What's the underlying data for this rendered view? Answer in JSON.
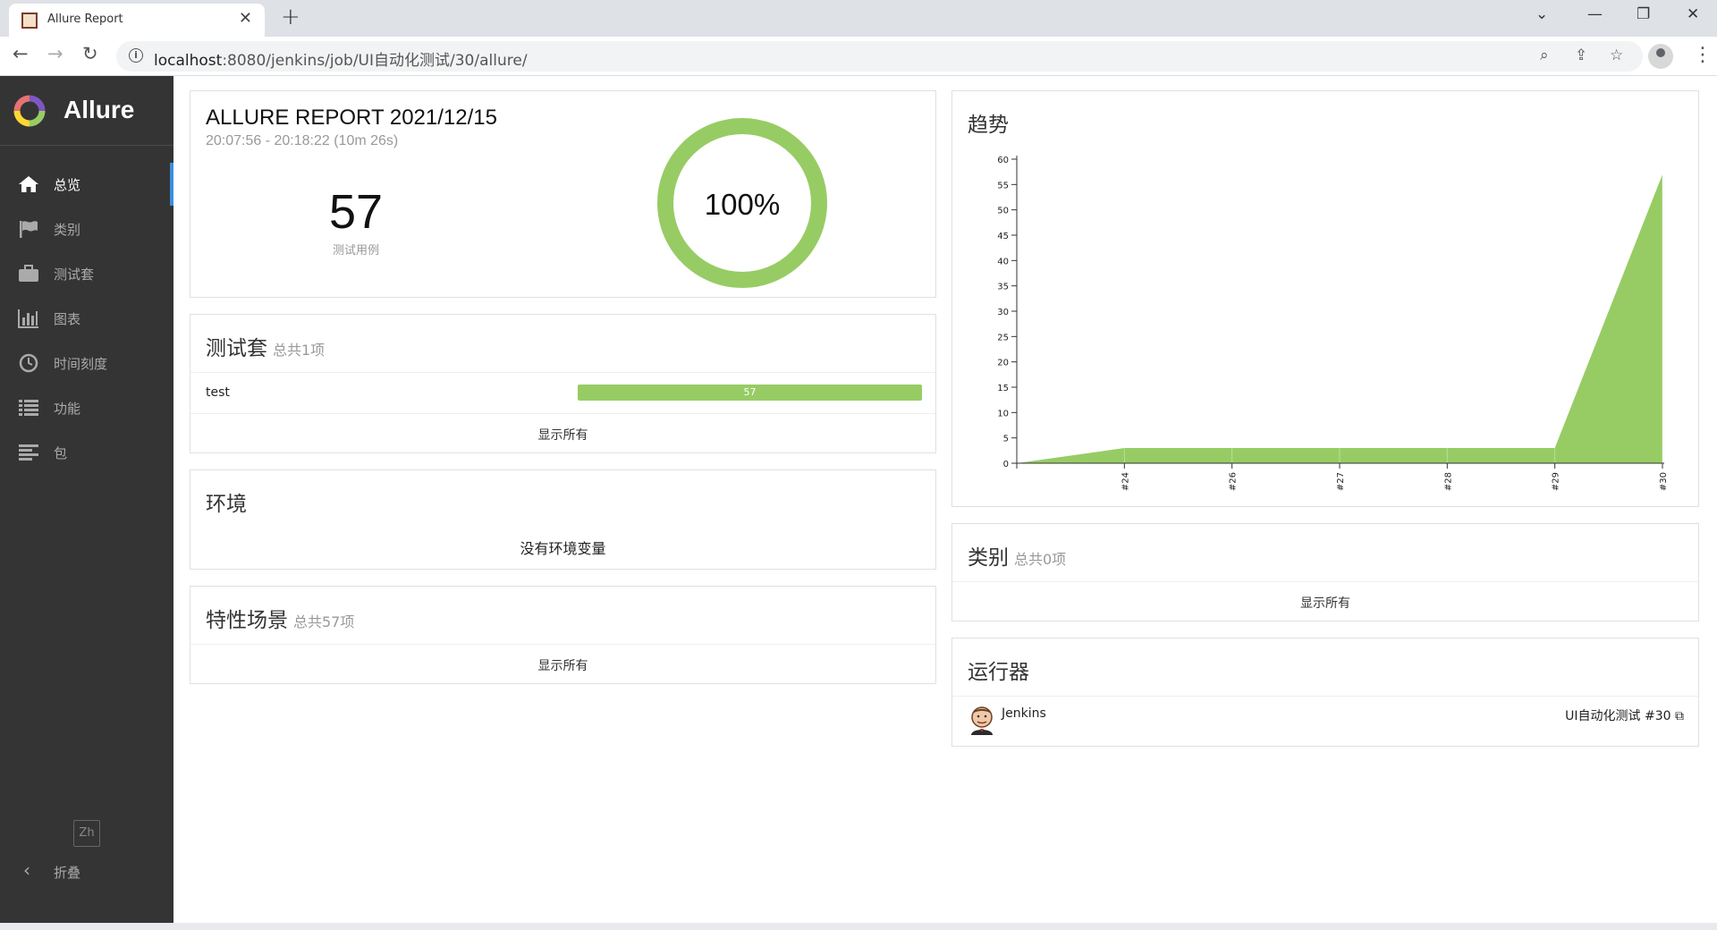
{
  "browser": {
    "tab_title": "Allure Report",
    "url_host": "localhost",
    "url_path": ":8080/jenkins/job/UI自动化测试/30/allure/"
  },
  "sidebar": {
    "brand": "Allure",
    "items": [
      {
        "label": "总览",
        "icon": "home-icon",
        "active": true
      },
      {
        "label": "类别",
        "icon": "flag-icon",
        "active": false
      },
      {
        "label": "测试套",
        "icon": "briefcase-icon",
        "active": false
      },
      {
        "label": "图表",
        "icon": "bar-chart-icon",
        "active": false
      },
      {
        "label": "时间刻度",
        "icon": "clock-icon",
        "active": false
      },
      {
        "label": "功能",
        "icon": "list-icon",
        "active": false
      },
      {
        "label": "包",
        "icon": "align-left-icon",
        "active": false
      }
    ],
    "language": "Zh",
    "collapse_label": "折叠"
  },
  "summary": {
    "title": "ALLURE REPORT 2021/12/15",
    "time_range": "20:07:56 - 20:18:22 (10m 26s)",
    "test_count": "57",
    "test_count_label": "测试用例",
    "success_rate": "100%",
    "success_fraction": 1.0
  },
  "suites": {
    "title": "测试套",
    "subtitle": "总共1项",
    "rows": [
      {
        "name": "test",
        "count": "57"
      }
    ],
    "show_all": "显示所有"
  },
  "environment": {
    "title": "环境",
    "empty_text": "没有环境变量"
  },
  "features": {
    "title": "特性场景",
    "subtitle": "总共57项",
    "show_all": "显示所有"
  },
  "trend": {
    "title": "趋势"
  },
  "categories": {
    "title": "类别",
    "subtitle": "总共0项",
    "show_all": "显示所有"
  },
  "executors": {
    "title": "运行器",
    "name": "Jenkins",
    "build_link": "UI自动化测试 #30"
  },
  "colors": {
    "passed": "#97cc64",
    "sidebar_bg": "#343434",
    "active_marker": "#3b8ede"
  },
  "chart_data": {
    "type": "area",
    "x": [
      "",
      "#24",
      "#26",
      "#27",
      "#28",
      "#29",
      "#30"
    ],
    "series": [
      {
        "values": [
          0,
          3,
          3,
          3,
          3,
          3,
          57
        ]
      }
    ],
    "ylim": [
      0,
      60
    ],
    "yticks": [
      0,
      5,
      10,
      15,
      20,
      25,
      30,
      35,
      40,
      45,
      50,
      55,
      60
    ],
    "grid": false
  }
}
